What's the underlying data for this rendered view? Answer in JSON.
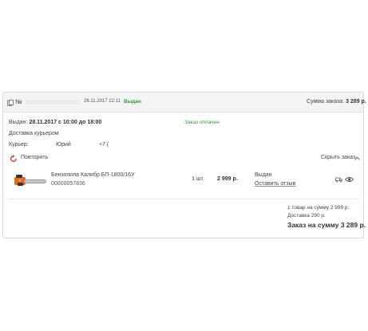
{
  "order": {
    "number_label": "№",
    "date": "26.11.2017 22:11",
    "status": "Выдан",
    "sum_label": "Сумма заказа:",
    "sum_value": "3 289 р."
  },
  "delivery": {
    "issued_label": "Выдан:",
    "issued_value": "28.11.2017 с 10:00 до 18:00",
    "payment_status": "Заказ оплачен",
    "method": "Доставка курьером",
    "courier_label": "Курьер:",
    "courier_name": "Юрий",
    "courier_phone": "+7 ("
  },
  "actions": {
    "repeat_label": "Повторить",
    "hide_label": "Скрыть заказ"
  },
  "items": [
    {
      "name": "Бензопила Калибр БП-1800/16У",
      "code": "00000057836",
      "quantity": "1 шт.",
      "price": "2 999 р.",
      "status": "Выдан",
      "review_label": "Оставить отзыв"
    }
  ],
  "summary": {
    "items_line": "1 товар на сумму 2 999 р.",
    "delivery_line": "Доставка 290 р.",
    "total_line": "Заказ на сумму 3 289 р."
  },
  "icons": {
    "order": "document-icon",
    "repeat": "repeat-icon",
    "hide": "chevron-up-icon",
    "truck": "truck-icon",
    "view": "eye-icon"
  },
  "colors": {
    "status_green": "#2e9f2e",
    "repeat_red": "#d9302a",
    "product_orange": "#e06a1b"
  }
}
